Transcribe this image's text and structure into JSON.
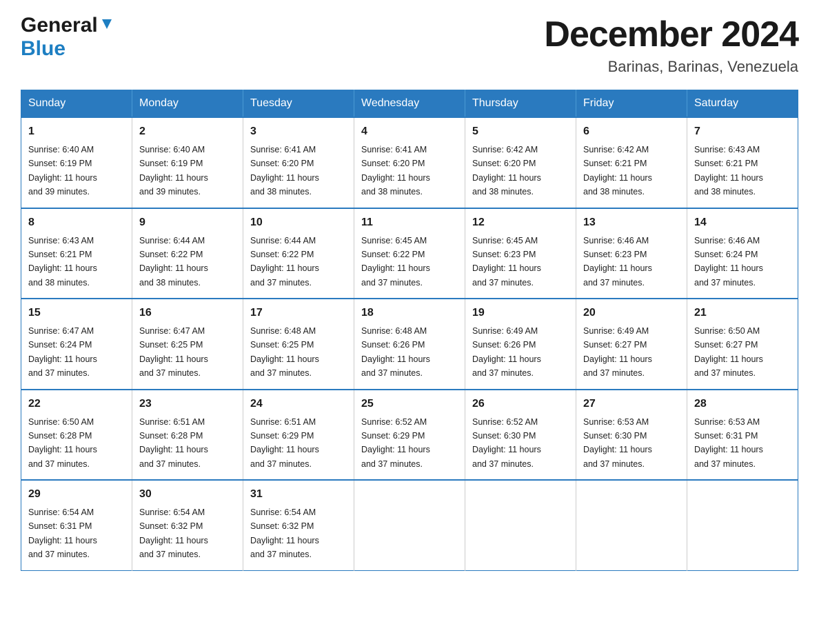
{
  "header": {
    "logo_general": "General",
    "logo_blue": "Blue",
    "month_title": "December 2024",
    "location": "Barinas, Barinas, Venezuela"
  },
  "days_of_week": [
    "Sunday",
    "Monday",
    "Tuesday",
    "Wednesday",
    "Thursday",
    "Friday",
    "Saturday"
  ],
  "weeks": [
    [
      {
        "day": "1",
        "sunrise": "6:40 AM",
        "sunset": "6:19 PM",
        "daylight": "11 hours and 39 minutes."
      },
      {
        "day": "2",
        "sunrise": "6:40 AM",
        "sunset": "6:19 PM",
        "daylight": "11 hours and 39 minutes."
      },
      {
        "day": "3",
        "sunrise": "6:41 AM",
        "sunset": "6:20 PM",
        "daylight": "11 hours and 38 minutes."
      },
      {
        "day": "4",
        "sunrise": "6:41 AM",
        "sunset": "6:20 PM",
        "daylight": "11 hours and 38 minutes."
      },
      {
        "day": "5",
        "sunrise": "6:42 AM",
        "sunset": "6:20 PM",
        "daylight": "11 hours and 38 minutes."
      },
      {
        "day": "6",
        "sunrise": "6:42 AM",
        "sunset": "6:21 PM",
        "daylight": "11 hours and 38 minutes."
      },
      {
        "day": "7",
        "sunrise": "6:43 AM",
        "sunset": "6:21 PM",
        "daylight": "11 hours and 38 minutes."
      }
    ],
    [
      {
        "day": "8",
        "sunrise": "6:43 AM",
        "sunset": "6:21 PM",
        "daylight": "11 hours and 38 minutes."
      },
      {
        "day": "9",
        "sunrise": "6:44 AM",
        "sunset": "6:22 PM",
        "daylight": "11 hours and 38 minutes."
      },
      {
        "day": "10",
        "sunrise": "6:44 AM",
        "sunset": "6:22 PM",
        "daylight": "11 hours and 37 minutes."
      },
      {
        "day": "11",
        "sunrise": "6:45 AM",
        "sunset": "6:22 PM",
        "daylight": "11 hours and 37 minutes."
      },
      {
        "day": "12",
        "sunrise": "6:45 AM",
        "sunset": "6:23 PM",
        "daylight": "11 hours and 37 minutes."
      },
      {
        "day": "13",
        "sunrise": "6:46 AM",
        "sunset": "6:23 PM",
        "daylight": "11 hours and 37 minutes."
      },
      {
        "day": "14",
        "sunrise": "6:46 AM",
        "sunset": "6:24 PM",
        "daylight": "11 hours and 37 minutes."
      }
    ],
    [
      {
        "day": "15",
        "sunrise": "6:47 AM",
        "sunset": "6:24 PM",
        "daylight": "11 hours and 37 minutes."
      },
      {
        "day": "16",
        "sunrise": "6:47 AM",
        "sunset": "6:25 PM",
        "daylight": "11 hours and 37 minutes."
      },
      {
        "day": "17",
        "sunrise": "6:48 AM",
        "sunset": "6:25 PM",
        "daylight": "11 hours and 37 minutes."
      },
      {
        "day": "18",
        "sunrise": "6:48 AM",
        "sunset": "6:26 PM",
        "daylight": "11 hours and 37 minutes."
      },
      {
        "day": "19",
        "sunrise": "6:49 AM",
        "sunset": "6:26 PM",
        "daylight": "11 hours and 37 minutes."
      },
      {
        "day": "20",
        "sunrise": "6:49 AM",
        "sunset": "6:27 PM",
        "daylight": "11 hours and 37 minutes."
      },
      {
        "day": "21",
        "sunrise": "6:50 AM",
        "sunset": "6:27 PM",
        "daylight": "11 hours and 37 minutes."
      }
    ],
    [
      {
        "day": "22",
        "sunrise": "6:50 AM",
        "sunset": "6:28 PM",
        "daylight": "11 hours and 37 minutes."
      },
      {
        "day": "23",
        "sunrise": "6:51 AM",
        "sunset": "6:28 PM",
        "daylight": "11 hours and 37 minutes."
      },
      {
        "day": "24",
        "sunrise": "6:51 AM",
        "sunset": "6:29 PM",
        "daylight": "11 hours and 37 minutes."
      },
      {
        "day": "25",
        "sunrise": "6:52 AM",
        "sunset": "6:29 PM",
        "daylight": "11 hours and 37 minutes."
      },
      {
        "day": "26",
        "sunrise": "6:52 AM",
        "sunset": "6:30 PM",
        "daylight": "11 hours and 37 minutes."
      },
      {
        "day": "27",
        "sunrise": "6:53 AM",
        "sunset": "6:30 PM",
        "daylight": "11 hours and 37 minutes."
      },
      {
        "day": "28",
        "sunrise": "6:53 AM",
        "sunset": "6:31 PM",
        "daylight": "11 hours and 37 minutes."
      }
    ],
    [
      {
        "day": "29",
        "sunrise": "6:54 AM",
        "sunset": "6:31 PM",
        "daylight": "11 hours and 37 minutes."
      },
      {
        "day": "30",
        "sunrise": "6:54 AM",
        "sunset": "6:32 PM",
        "daylight": "11 hours and 37 minutes."
      },
      {
        "day": "31",
        "sunrise": "6:54 AM",
        "sunset": "6:32 PM",
        "daylight": "11 hours and 37 minutes."
      },
      null,
      null,
      null,
      null
    ]
  ],
  "labels": {
    "sunrise": "Sunrise:",
    "sunset": "Sunset:",
    "daylight": "Daylight:"
  }
}
